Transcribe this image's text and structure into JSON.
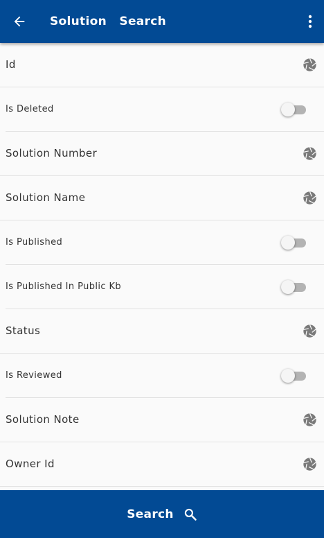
{
  "appbar": {
    "title": "Solution  Search",
    "back_icon": "arrow-back-icon",
    "menu_icon": "more-vertical-icon",
    "color": "#024a94"
  },
  "fields": [
    {
      "label": "Id",
      "type": "lookup",
      "icon": "aperture-icon"
    },
    {
      "label": "Is Deleted",
      "type": "toggle",
      "value": false
    },
    {
      "label": "Solution Number",
      "type": "lookup",
      "icon": "aperture-icon"
    },
    {
      "label": "Solution Name",
      "type": "lookup",
      "icon": "aperture-icon"
    },
    {
      "label": "Is Published",
      "type": "toggle",
      "value": false
    },
    {
      "label": "Is Published In Public Kb",
      "type": "toggle",
      "value": false
    },
    {
      "label": "Status",
      "type": "lookup",
      "icon": "aperture-icon"
    },
    {
      "label": "Is Reviewed",
      "type": "toggle",
      "value": false
    },
    {
      "label": "Solution Note",
      "type": "lookup",
      "icon": "aperture-icon"
    },
    {
      "label": "Owner Id",
      "type": "lookup",
      "icon": "aperture-icon"
    }
  ],
  "footer": {
    "search_label": "Search",
    "search_icon": "search-icon"
  }
}
